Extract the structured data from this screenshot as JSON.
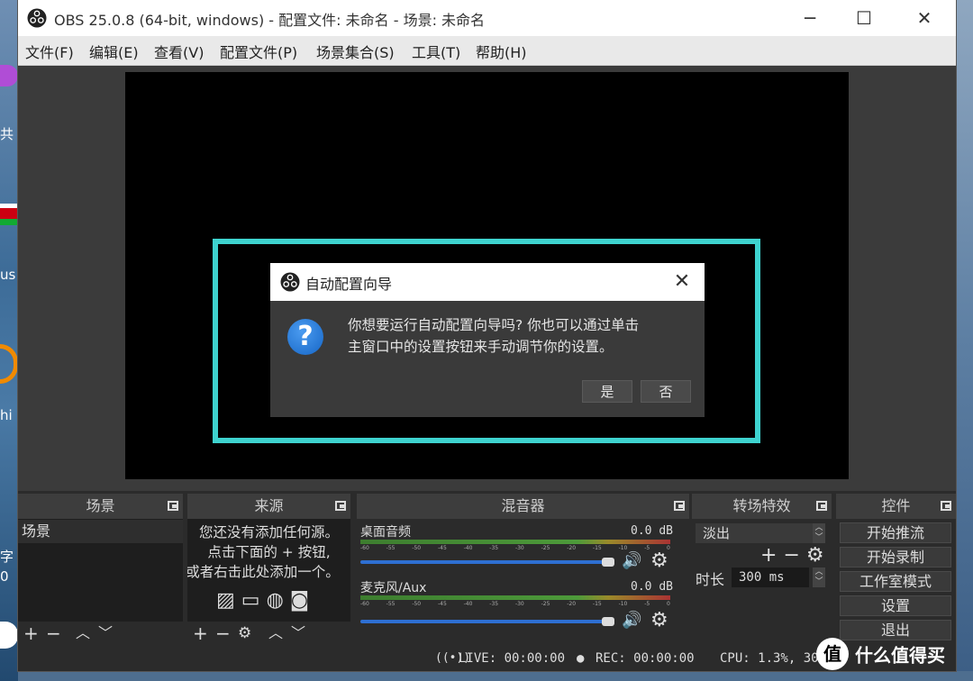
{
  "window": {
    "title": "OBS 25.0.8 (64-bit, windows) - 配置文件: 未命名 - 场景: 未命名",
    "minimize_glyph": "─",
    "maximize_glyph": "☐",
    "close_glyph": "✕"
  },
  "menu": [
    "文件(F)",
    "编辑(E)",
    "查看(V)",
    "配置文件(P)",
    "场景集合(S)",
    "工具(T)",
    "帮助(H)"
  ],
  "dialog": {
    "title": "自动配置向导",
    "message_line1": "你想要运行自动配置向导吗? 你也可以通过单击",
    "message_line2": "主窗口中的设置按钮来手动调节你的设置。",
    "yes": "是",
    "no": "否",
    "icon": "question-icon",
    "highlight_color": "#3ed3cf"
  },
  "docks": {
    "scenes": {
      "title": "场景",
      "items": [
        "场景"
      ]
    },
    "sources": {
      "title": "来源",
      "empty_line1": "您还没有添加任何源。",
      "empty_line2": "点击下面的 + 按钮,",
      "empty_line3": "或者右击此处添加一个。"
    },
    "mixer": {
      "title": "混音器",
      "channels": [
        {
          "name": "桌面音频",
          "db": "0.0 dB"
        },
        {
          "name": "麦克风/Aux",
          "db": "0.0 dB"
        }
      ],
      "scale": [
        "-60",
        "-55",
        "-50",
        "-45",
        "-40",
        "-35",
        "-30",
        "-25",
        "-20",
        "-15",
        "-10",
        "-5",
        "0"
      ]
    },
    "transitions": {
      "title": "转场特效",
      "selected": "淡出",
      "duration_label": "时长",
      "duration_value": "300 ms"
    },
    "controls": {
      "title": "控件",
      "buttons": [
        "开始推流",
        "开始录制",
        "工作室模式",
        "设置",
        "退出"
      ]
    }
  },
  "status": {
    "live": "LIVE: 00:00:00",
    "rec": "REC: 00:00:00",
    "cpu": "CPU: 1.3%, 30"
  },
  "desktop": {
    "labels": [
      "共",
      "us",
      "hi",
      "字",
      "0"
    ]
  },
  "watermark": "什么值得买"
}
